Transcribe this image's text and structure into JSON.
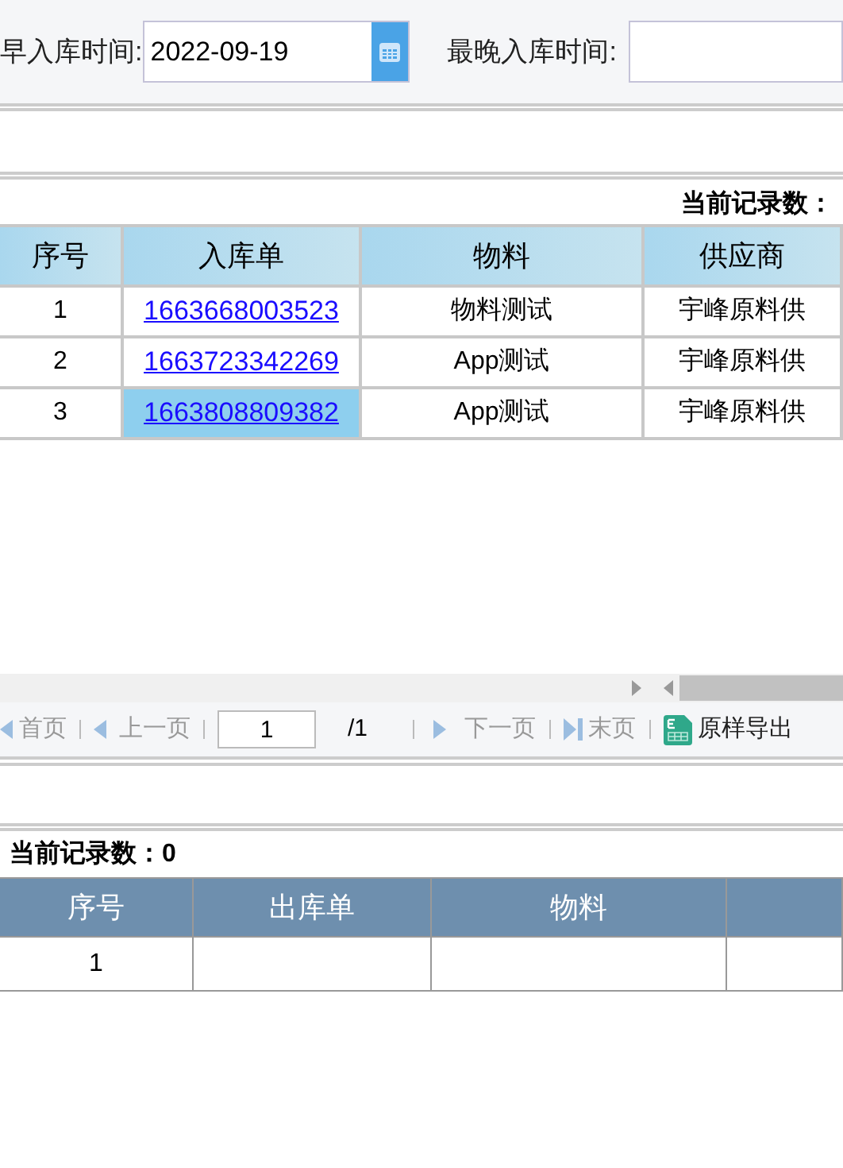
{
  "filters": [
    {
      "label": "早入库时间:",
      "value": "2022-09-19",
      "has_picker": true
    },
    {
      "label": "最晚入库时间:",
      "has_picker": false
    }
  ],
  "inbound": {
    "record_count": "当前记录数：",
    "columns": [
      "序号",
      "入库单",
      "物料",
      "供应商"
    ],
    "rows": [
      {
        "cells": [
          "1",
          "1663668003523",
          "物料测试",
          "宇峰原料供"
        ],
        "selected": false
      },
      {
        "cells": [
          "2",
          "1663723342269",
          "App测试",
          "宇峰原料供"
        ],
        "selected": false
      },
      {
        "cells": [
          "3",
          "1663808809382",
          "App测试",
          "宇峰原料供"
        ],
        "selected": true
      }
    ]
  },
  "pager": {
    "first": "首页",
    "prev": "上一页",
    "page": "1",
    "total": "/1",
    "next": "下一页",
    "last": "末页",
    "export": "原样导出"
  },
  "outbound": {
    "record_count": "当前记录数：0",
    "columns": [
      "序号",
      "出库单",
      "物料"
    ],
    "rows": [
      {
        "cells": [
          "1",
          "",
          "",
          ""
        ]
      }
    ]
  }
}
